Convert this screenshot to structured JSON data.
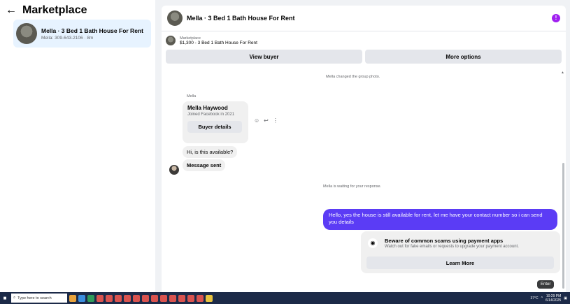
{
  "left": {
    "title": "Marketplace",
    "conversation": {
      "title": "Mella · 3 Bed 1 Bath House For Rent",
      "subtitle": "Mella: 309-643-2106 · 8m"
    }
  },
  "chat": {
    "header_title": "Mella · 3 Bed 1 Bath House For Rent",
    "listing_label": "Marketplace",
    "listing_price": "$1,300 - 3 Bed 1 Bath House For Rent",
    "view_buyer": "View buyer",
    "more_options": "More options",
    "system_photo": "Mella changed the group photo.",
    "sender_name": "Mella",
    "card_name": "Mella Haywood",
    "card_joined": "Joined Facebook in 2021",
    "card_button": "Buyer details",
    "msg_available": "Hi, is this available?",
    "msg_sent": "Message sent",
    "system_waiting": "Mella is waiting for your response.",
    "reply": "Hello, yes the house is still available for rent, let me have your contact number so i can send you  details",
    "scam_title": "Beware of common scams using payment apps",
    "scam_sub": "Watch out for fake emails or requests to upgrade your payment account.",
    "learn_more": "Learn More",
    "enter_tip": "Enter"
  },
  "taskbar": {
    "search_placeholder": "Type here to search",
    "weather": "37°C",
    "time": "10:29 PM",
    "date": "6/14/2025"
  },
  "colors": {
    "accent_bubble": "#5b3cf5",
    "info_icon": "#a020f0",
    "taskbar": "#1c2a48"
  }
}
